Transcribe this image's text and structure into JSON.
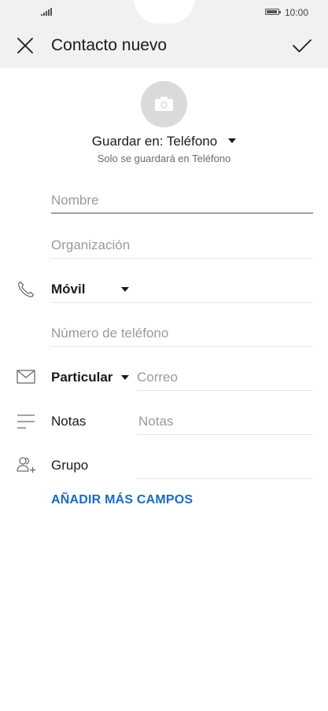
{
  "status_bar": {
    "time": "10:00",
    "icons": [
      "signal-icon",
      "battery-icon"
    ]
  },
  "toolbar": {
    "title": "Contacto nuevo",
    "close_icon": "close-icon",
    "confirm_icon": "checkmark-icon"
  },
  "photo": {
    "icon": "camera-icon"
  },
  "storage": {
    "label": "Guardar en: Teléfono",
    "note": "Solo se guardará en Teléfono"
  },
  "fields": {
    "name_placeholder": "Nombre",
    "organization_placeholder": "Organización",
    "phone_type": "Móvil",
    "phone_placeholder": "Número de teléfono",
    "email_type": "Particular",
    "email_placeholder": "Correo",
    "notes_label": "Notas",
    "notes_placeholder": "Notas",
    "group_label": "Grupo"
  },
  "actions": {
    "add_more_fields": "AÑADIR MÁS CAMPOS"
  },
  "colors": {
    "accent": "#1a6bbf",
    "header_bg": "#f1f1f1",
    "placeholder": "#9a9a9a"
  }
}
